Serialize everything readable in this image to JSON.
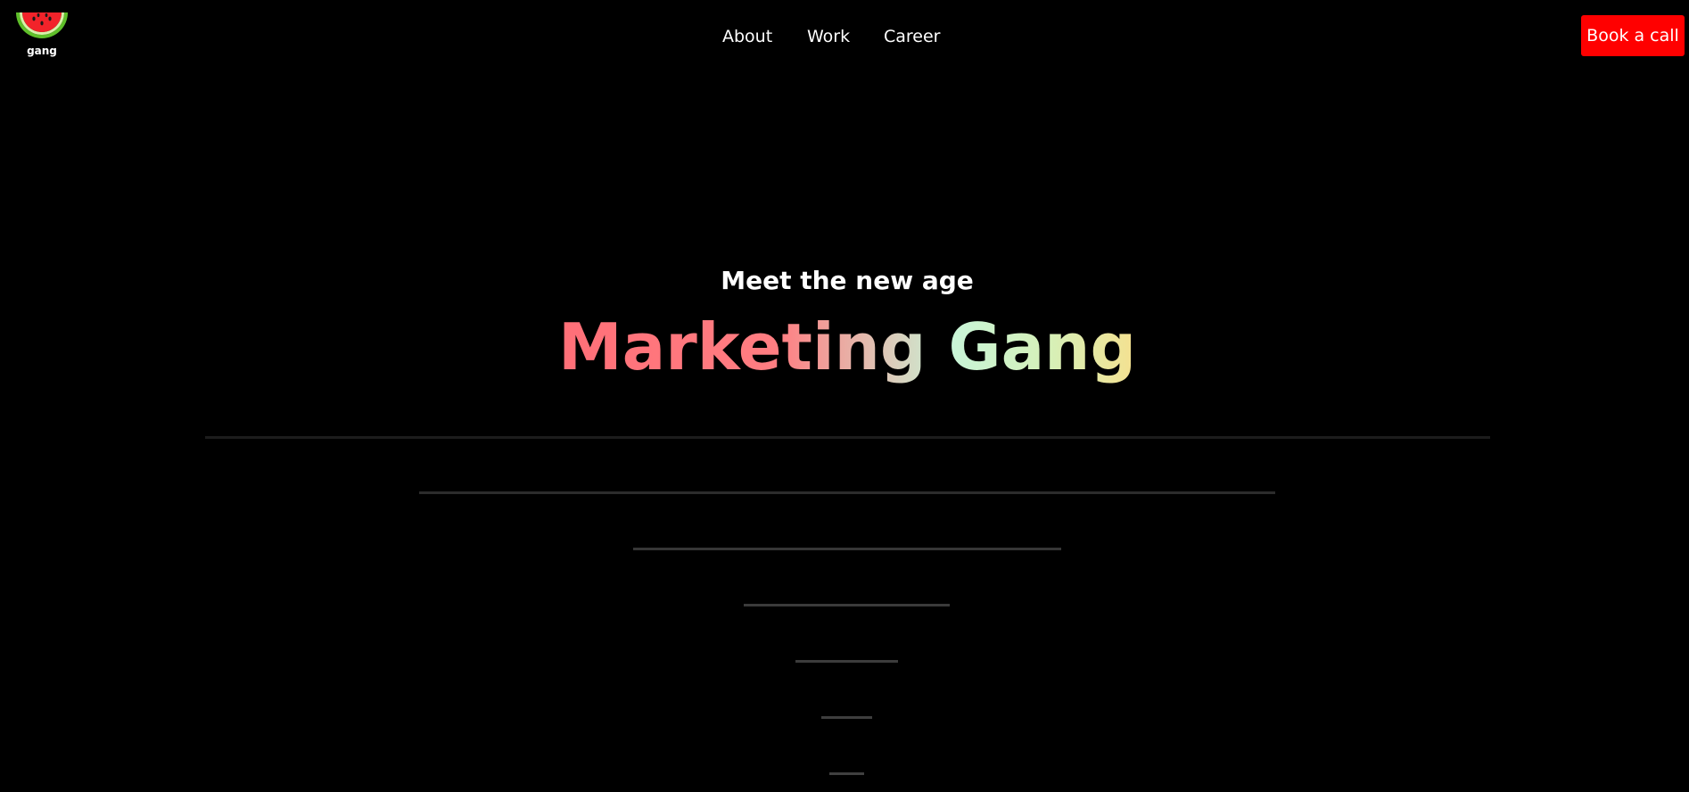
{
  "header": {
    "logo_text": "gang",
    "nav": {
      "about": "About",
      "work": "Work",
      "career": "Career"
    },
    "cta_label": "Book a call"
  },
  "hero": {
    "kicker": "Meet the new age",
    "title": "Marketing Gang"
  },
  "colors": {
    "background": "#000000",
    "cta": "#ff0000",
    "title_gradient": [
      "#ff6f78",
      "#ff7e82",
      "#c8f5d8",
      "#d6f0b8",
      "#f5e190"
    ]
  },
  "icons": {
    "logo": "watermelon-slice-icon"
  }
}
